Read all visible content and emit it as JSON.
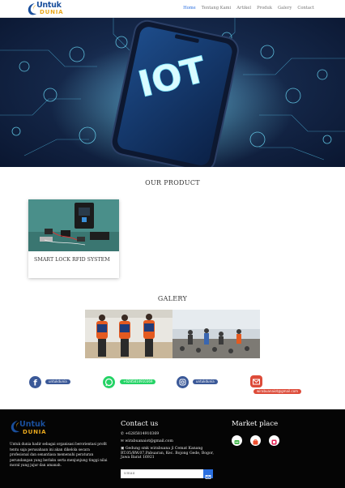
{
  "brand": {
    "line1": "Untuk",
    "line2": "DUNIA"
  },
  "nav": {
    "items": [
      {
        "label": "Home"
      },
      {
        "label": "Tentang Kami"
      },
      {
        "label": "Artikel"
      },
      {
        "label": "Produk"
      },
      {
        "label": "Galery"
      },
      {
        "label": "Contact"
      }
    ]
  },
  "hero": {
    "text": "IOT",
    "slide_count": 3,
    "active_slide": 1
  },
  "product": {
    "title": "OUR PRODUCT",
    "card": {
      "caption": "SMART LOCK RFID SYSTEM"
    }
  },
  "galery": {
    "title": "GALERY"
  },
  "social": {
    "facebook": {
      "label": "untukdunia",
      "icon": "facebook-icon",
      "color": "#3b5998"
    },
    "whatsapp": {
      "label": "+6285814910369",
      "icon": "whatsapp-icon",
      "color": "#25d366"
    },
    "instagram": {
      "label": "untukdunia",
      "icon": "instagram-icon",
      "color": "#3b5998"
    },
    "email": {
      "label": "wirabuanaiot@gmail.com",
      "icon": "mail-icon",
      "color": "#dd4b39"
    }
  },
  "footer": {
    "about": "Untuk dunia hadir sebagai organisasi berorientasi profit tentu saja perusahaan ini akan dikelola secara profesional dan senantiasa memenuhi peraturan perundangan yang berlaku serta menjunjung tinggi nilai moral yang jujur dan amanah.",
    "contact_title": "Contact us",
    "phone": "+6285814910369",
    "email": "wirabuanaiot@gmail.com",
    "address": "Gedung smk wirabuana jl Cemat Kanang RT.05/RW.07,Pabuaran, Kec. Bojong Gede, Bogor, Jawa Barat 16921",
    "email_placeholder": "Email",
    "market_title": "Market place"
  },
  "colors": {
    "accent": "#2a6fe0",
    "brand_blue": "#1a4f9c",
    "brand_yellow": "#e9a81d",
    "footer_bg": "#050505"
  }
}
